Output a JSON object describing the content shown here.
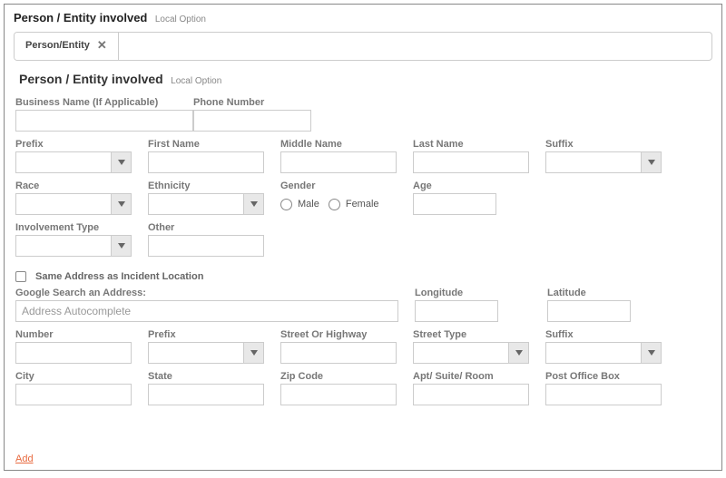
{
  "section": {
    "title": "Person / Entity involved",
    "subtitle": "Local Option"
  },
  "tab": {
    "label": "Person/Entity"
  },
  "inner": {
    "title": "Person / Entity involved",
    "subtitle": "Local Option"
  },
  "labels": {
    "businessName": "Business Name (If Applicable)",
    "phone": "Phone Number",
    "prefix": "Prefix",
    "firstName": "First Name",
    "middleName": "Middle Name",
    "lastName": "Last Name",
    "suffix": "Suffix",
    "race": "Race",
    "ethnicity": "Ethnicity",
    "gender": "Gender",
    "male": "Male",
    "female": "Female",
    "age": "Age",
    "involvementType": "Involvement Type",
    "other": "Other",
    "sameAddress": "Same Address as Incident Location",
    "googleSearch": "Google Search an Address:",
    "addressPlaceholder": "Address Autocomplete",
    "longitude": "Longitude",
    "latitude": "Latitude",
    "number": "Number",
    "addrPrefix": "Prefix",
    "streetOrHighway": "Street Or Highway",
    "streetType": "Street Type",
    "addrSuffix": "Suffix",
    "city": "City",
    "state": "State",
    "zip": "Zip Code",
    "apt": "Apt/ Suite/ Room",
    "poBox": "Post Office Box"
  },
  "values": {
    "businessName": "",
    "phone": "",
    "prefix": "",
    "firstName": "",
    "middleName": "",
    "lastName": "",
    "suffix": "",
    "race": "",
    "ethnicity": "",
    "age": "",
    "involvementType": "",
    "other": "",
    "googleSearch": "",
    "longitude": "",
    "latitude": "",
    "number": "",
    "addrPrefix": "",
    "streetOrHighway": "",
    "streetType": "",
    "addrSuffix": "",
    "city": "",
    "state": "",
    "zip": "",
    "apt": "",
    "poBox": ""
  },
  "addLink": "Add"
}
